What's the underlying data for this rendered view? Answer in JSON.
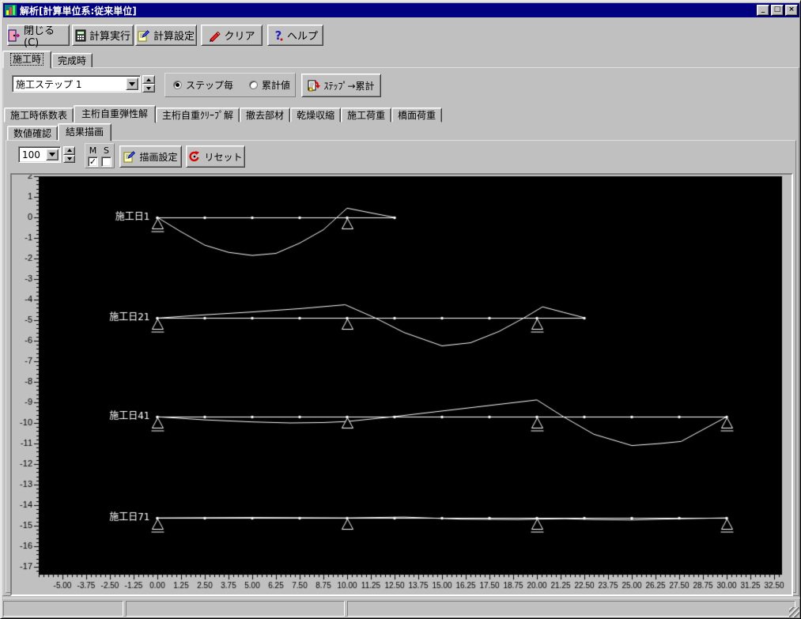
{
  "window": {
    "title": "解析[計算単位系:従来単位]",
    "controls": {
      "minimize": "_",
      "maximize": "□",
      "close": "×"
    }
  },
  "toolbar": {
    "buttons": [
      {
        "label": "閉じる(C)",
        "icon": "door-exit-icon"
      },
      {
        "label": "計算実行",
        "icon": "calculator-icon"
      },
      {
        "label": "計算設定",
        "icon": "settings-doc-icon"
      },
      {
        "label": "クリア",
        "icon": "eraser-pencil-icon"
      },
      {
        "label": "ヘルプ",
        "icon": "help-icon"
      }
    ]
  },
  "main_tabs": {
    "items": [
      {
        "label": "施工時",
        "selected": true
      },
      {
        "label": "完成時",
        "selected": false
      }
    ]
  },
  "step_panel": {
    "step_select": {
      "value": "施工ステップ 1"
    },
    "mode_radio": {
      "options": [
        {
          "label": "ステップ毎",
          "selected": true
        },
        {
          "label": "累計値",
          "selected": false
        }
      ]
    },
    "step_to_total_button": {
      "label": "ｽﾃｯﾌﾟ→累計",
      "icon": "step-to-total-icon"
    }
  },
  "result_tabs": {
    "items": [
      "施工時係数表",
      "主桁自重弾性解",
      "主桁自重ｸﾘｰﾌﾟ解",
      "撤去部材",
      "乾燥収縮",
      "施工荷重",
      "橋面荷重"
    ],
    "selected_index": 1
  },
  "view_tabs": {
    "items": [
      "数値確認",
      "結果描画"
    ],
    "selected_index": 1
  },
  "draw_controls": {
    "scale_select": {
      "value": "100"
    },
    "m_checkbox": {
      "label": "M",
      "checked": true
    },
    "s_checkbox": {
      "label": "S",
      "checked": false
    },
    "draw_settings_button": {
      "label": "描画設定",
      "icon": "draw-settings-icon"
    },
    "reset_button": {
      "label": "リセット",
      "icon": "reset-icon"
    }
  },
  "chart_data": {
    "type": "line",
    "bg": "#000000",
    "fg": "#ffffff",
    "axis_text_color": "#000000",
    "xlim": [
      -6.25,
      32.9
    ],
    "ylim": [
      -17.4,
      2.2
    ],
    "x_minor_step": 0.25,
    "y_minor_step": 0.2,
    "x_major_ticks": [
      -5,
      -3.75,
      -2.5,
      -1.25,
      0,
      1.25,
      2.5,
      3.75,
      5,
      6.25,
      7.5,
      8.75,
      10,
      11.25,
      12.5,
      13.75,
      15,
      16.25,
      17.5,
      18.75,
      20,
      21.25,
      22.5,
      23.75,
      25,
      26.25,
      27.5,
      28.75,
      30,
      31.25,
      32.5
    ],
    "x_tick_labels": [
      "-5.00",
      "-3.75",
      "-2.50",
      "-1.25",
      "0.00",
      "1.25",
      "2.50",
      "3.75",
      "5.00",
      "6.25",
      "7.50",
      "8.75",
      "10.00",
      "11.25",
      "12.50",
      "13.75",
      "15.00",
      "16.25",
      "17.50",
      "18.75",
      "20.00",
      "21.25",
      "22.50",
      "23.75",
      "25.00",
      "26.25",
      "27.50",
      "28.75",
      "30.00",
      "31.25",
      "32.50"
    ],
    "y_major_ticks": [
      2,
      1,
      0,
      -1,
      -2,
      -3,
      -4,
      -5,
      -6,
      -7,
      -8,
      -9,
      -10,
      -11,
      -12,
      -13,
      -14,
      -15,
      -16,
      -17
    ],
    "series": [
      {
        "name": "施工日1",
        "baseline": 0,
        "beam_start": 0,
        "beam_end": 12.5,
        "node_step": 2.5,
        "supports": [
          {
            "x": 0,
            "roller": true
          },
          {
            "x": 10,
            "roller": false
          }
        ],
        "deflection": [
          [
            0,
            0
          ],
          [
            1.25,
            -0.7
          ],
          [
            2.5,
            -1.35
          ],
          [
            3.75,
            -1.7
          ],
          [
            5,
            -1.85
          ],
          [
            6.25,
            -1.75
          ],
          [
            7.5,
            -1.25
          ],
          [
            8.75,
            -0.6
          ],
          [
            10,
            0.45
          ],
          [
            11.25,
            0.22
          ],
          [
            12.5,
            0
          ]
        ]
      },
      {
        "name": "施工日21",
        "baseline": -4.9,
        "beam_start": 0,
        "beam_end": 22.5,
        "node_step": 2.5,
        "supports": [
          {
            "x": 0,
            "roller": true
          },
          {
            "x": 10,
            "roller": false
          },
          {
            "x": 20,
            "roller": true
          }
        ],
        "deflection": [
          [
            0,
            -4.9
          ],
          [
            2.5,
            -4.74
          ],
          [
            5,
            -4.6
          ],
          [
            7.5,
            -4.44
          ],
          [
            9.9,
            -4.25
          ],
          [
            11.5,
            -4.9
          ],
          [
            13,
            -5.6
          ],
          [
            15,
            -6.25
          ],
          [
            16.5,
            -6.1
          ],
          [
            18,
            -5.55
          ],
          [
            19.3,
            -4.9
          ],
          [
            20.3,
            -4.35
          ],
          [
            21.4,
            -4.62
          ],
          [
            22.5,
            -4.88
          ]
        ]
      },
      {
        "name": "施工日41",
        "baseline": -9.7,
        "beam_start": 0,
        "beam_end": 30,
        "node_step": 2.5,
        "supports": [
          {
            "x": 0,
            "roller": true
          },
          {
            "x": 10,
            "roller": false
          },
          {
            "x": 20,
            "roller": true
          },
          {
            "x": 30,
            "roller": true
          }
        ],
        "deflection": [
          [
            0,
            -9.7
          ],
          [
            2.5,
            -9.85
          ],
          [
            5,
            -9.95
          ],
          [
            7,
            -10.0
          ],
          [
            8.75,
            -9.98
          ],
          [
            10,
            -9.93
          ],
          [
            12.4,
            -9.7
          ],
          [
            15,
            -9.42
          ],
          [
            17.5,
            -9.15
          ],
          [
            20,
            -8.88
          ],
          [
            21.4,
            -9.7
          ],
          [
            23,
            -10.55
          ],
          [
            25,
            -11.1
          ],
          [
            26.5,
            -11.0
          ],
          [
            27.6,
            -10.9
          ],
          [
            30,
            -9.7
          ]
        ]
      },
      {
        "name": "施工日71",
        "baseline": -14.62,
        "beam_start": 0,
        "beam_end": 30,
        "node_step": 2.5,
        "supports": [
          {
            "x": 0,
            "roller": true
          },
          {
            "x": 10,
            "roller": false
          },
          {
            "x": 20,
            "roller": true
          },
          {
            "x": 30,
            "roller": true
          }
        ],
        "deflection": [
          [
            0,
            -14.62
          ],
          [
            5,
            -14.6
          ],
          [
            10,
            -14.62
          ],
          [
            13,
            -14.58
          ],
          [
            16,
            -14.68
          ],
          [
            19,
            -14.7
          ],
          [
            20,
            -14.68
          ],
          [
            21.5,
            -14.66
          ],
          [
            23,
            -14.7
          ],
          [
            25,
            -14.72
          ],
          [
            26.5,
            -14.68
          ],
          [
            30,
            -14.62
          ]
        ]
      }
    ]
  },
  "status_bar": {
    "panels": [
      "",
      "",
      ""
    ]
  }
}
